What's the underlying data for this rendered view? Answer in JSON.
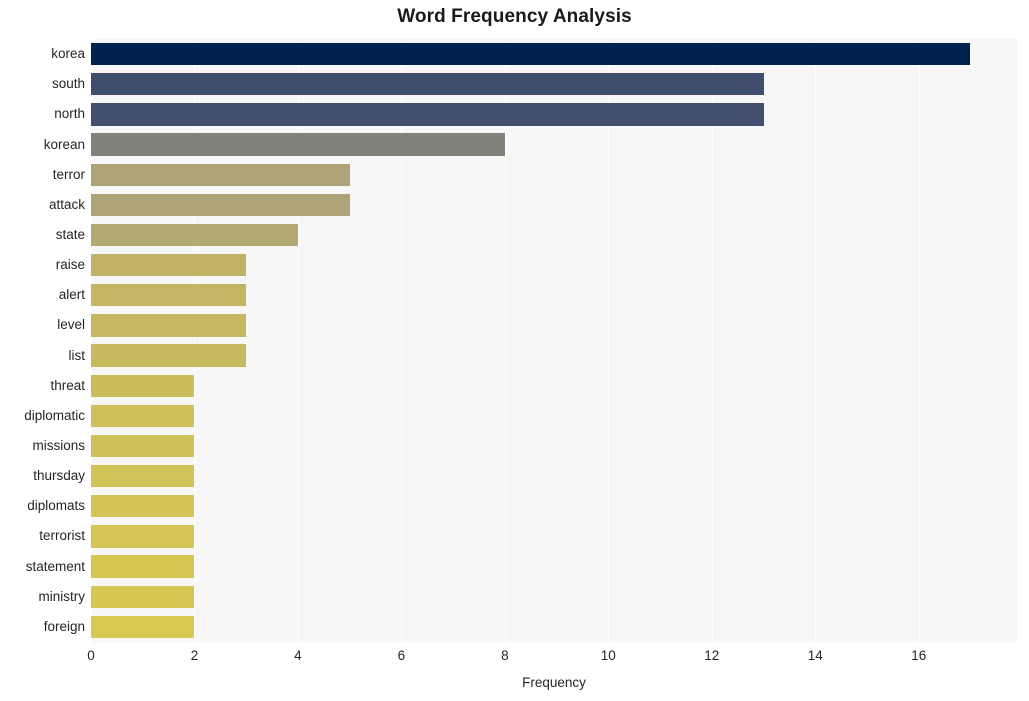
{
  "chart_data": {
    "type": "bar",
    "orientation": "horizontal",
    "title": "Word Frequency Analysis",
    "xlabel": "Frequency",
    "ylabel": "",
    "categories": [
      "korea",
      "south",
      "north",
      "korean",
      "terror",
      "attack",
      "state",
      "raise",
      "alert",
      "level",
      "list",
      "threat",
      "diplomatic",
      "missions",
      "thursday",
      "diplomats",
      "terrorist",
      "statement",
      "ministry",
      "foreign"
    ],
    "values": [
      17,
      13,
      13,
      8,
      5,
      5,
      4,
      3,
      3,
      3,
      3,
      2,
      2,
      2,
      2,
      2,
      2,
      2,
      2,
      2
    ],
    "bar_colors": [
      "#00224e",
      "#3f4e6e",
      "#434f6e",
      "#82817a",
      "#aea377",
      "#aea377",
      "#b4a971",
      "#c0b267",
      "#c3b564",
      "#c6b861",
      "#c8ba5f",
      "#ccbd5b",
      "#cec05a",
      "#d0c158",
      "#d1c357",
      "#d3c455",
      "#d4c554",
      "#d5c653",
      "#d6c752",
      "#d7c851"
    ],
    "xlim": [
      0,
      17.9
    ],
    "xticks": [
      0,
      2,
      4,
      6,
      8,
      10,
      12,
      14,
      16
    ],
    "xticklabels": [
      "0",
      "2",
      "4",
      "6",
      "8",
      "10",
      "12",
      "14",
      "16"
    ],
    "grid": true,
    "grid_axis": "x",
    "grid_color": "#ffffff",
    "plot_background": "#f7f7f7",
    "figure_background": "#ffffff",
    "legend": null
  }
}
